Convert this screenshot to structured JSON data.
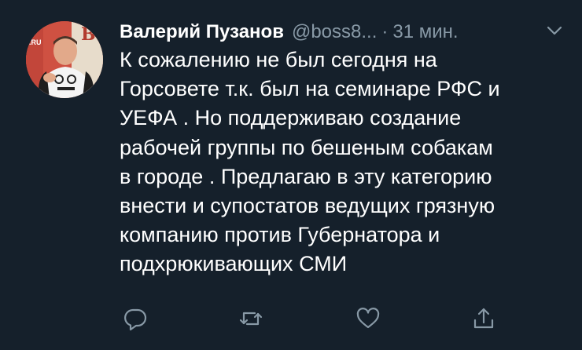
{
  "tweet": {
    "author_name": "Валерий Пузанов",
    "handle": "@boss8...",
    "separator": "·",
    "time": "31 мин.",
    "text_lines": [
      "К сожалению не был сегодня на",
      "Горсовете т.к. был на семинаре РФС и",
      "УЕФА . Но поддерживаю создание",
      "рабочей группы по бешеным собакам",
      "в городе . Предлагаю в эту категорию",
      "внести и супостатов ведущих грязную",
      "компанию против Губернатора и",
      "подхрюкивающих СМИ"
    ]
  },
  "icons": {
    "menu": "chevron-down-icon",
    "reply": "reply-icon",
    "retweet": "retweet-icon",
    "like": "heart-icon",
    "share": "share-icon"
  },
  "colors": {
    "background": "#15202b",
    "text": "#ffffff",
    "secondary": "#8899a6"
  }
}
